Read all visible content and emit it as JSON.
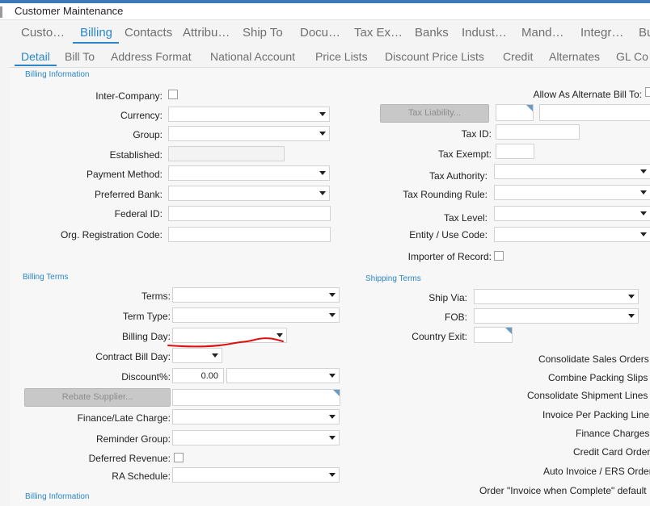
{
  "window": {
    "title": "Customer Maintenance"
  },
  "main_tabs": [
    "Custo…",
    "Billing",
    "Contacts",
    "Attribu…",
    "Ship To",
    "Docu…",
    "Tax Ex…",
    "Banks",
    "Indust…",
    "Mand…",
    "Integr…",
    "Bu"
  ],
  "sub_tabs": [
    "Detail",
    "Bill To",
    "Address Format",
    "National Account",
    "Price Lists",
    "Discount Price Lists",
    "Credit",
    "Alternates",
    "GL Co"
  ],
  "sections": {
    "billing_information": "Billing Information",
    "billing_terms": "Billing Terms",
    "shipping_terms": "Shipping Terms",
    "billing_information_2": "Billing Information"
  },
  "left_fields": {
    "inter_company": "Inter-Company:",
    "currency": "Currency:",
    "group": "Group:",
    "established": "Established:",
    "payment_method": "Payment Method:",
    "preferred_bank": "Preferred Bank:",
    "federal_id": "Federal ID:",
    "org_registration_code": "Org. Registration Code:"
  },
  "right_fields": {
    "allow_alternate": "Allow As Alternate Bill To:",
    "tax_liability_button": "Tax Liability...",
    "tax_id": "Tax ID:",
    "tax_exempt": "Tax Exempt:",
    "tax_authority": "Tax Authority:",
    "tax_rounding_rule": "Tax Rounding Rule:",
    "tax_level": "Tax Level:",
    "entity_use_code": "Entity / Use Code:",
    "importer_of_record": "Importer of Record:"
  },
  "terms_fields": {
    "terms": "Terms:",
    "term_type": "Term Type:",
    "billing_day": "Billing Day:",
    "contract_bill_day": "Contract Bill Day:",
    "discount": "Discount%:",
    "discount_value": "0.00",
    "rebate_supplier_button": "Rebate Supplier...",
    "finance_late_charge": "Finance/Late Charge:",
    "reminder_group": "Reminder Group:",
    "deferred_revenue": "Deferred Revenue:",
    "ra_schedule": "RA Schedule:"
  },
  "shipping_fields": {
    "ship_via": "Ship Via:",
    "fob": "FOB:",
    "country_exit": "Country Exit:"
  },
  "options": [
    "Consolidate Sales Orders",
    "Combine Packing Slips",
    "Consolidate Shipment Lines",
    "Invoice Per Packing Line",
    "Finance Charges",
    "Credit Card Order",
    "Auto Invoice / ERS Order",
    "Order \"Invoice when Complete\" default"
  ],
  "colors": {
    "accent": "#2a86c8",
    "annotation": "#e01010"
  }
}
